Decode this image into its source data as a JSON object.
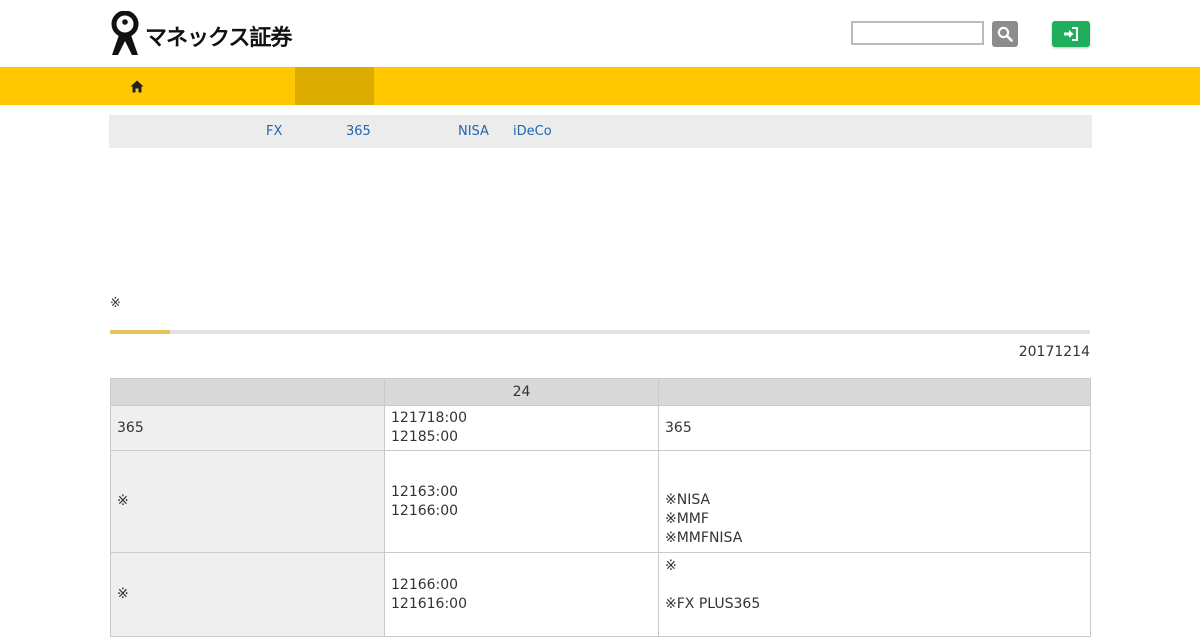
{
  "header": {
    "logo_text": "マネックス証券",
    "search": {
      "placeholder": ""
    },
    "icons": {
      "search": "search-icon",
      "login": "sign-in-icon",
      "home": "home-icon"
    }
  },
  "colors": {
    "nav": "#ffc800",
    "nav_active": "#dcac00",
    "login": "#1fae5b",
    "link": "#1f66b3"
  },
  "subnav": {
    "items": [
      "FX",
      "365",
      "NISA",
      "iDeCo"
    ]
  },
  "note": "※",
  "progress": {
    "fraction": 0.061
  },
  "date": "20171214",
  "table": {
    "headers": [
      "",
      "24",
      ""
    ],
    "rows": [
      {
        "label": "365",
        "times": [
          "121718:00",
          "12185:00"
        ],
        "notes": [
          "365"
        ]
      },
      {
        "label": "※",
        "times": [
          "12163:00",
          "12166:00"
        ],
        "notes": [
          "",
          "※NISA",
          "※MMF",
          "※MMFNISA"
        ]
      },
      {
        "label": "※",
        "times": [
          "12166:00",
          "121616:00"
        ],
        "notes": [
          "※",
          "",
          "※FX PLUS365",
          ""
        ]
      }
    ]
  }
}
